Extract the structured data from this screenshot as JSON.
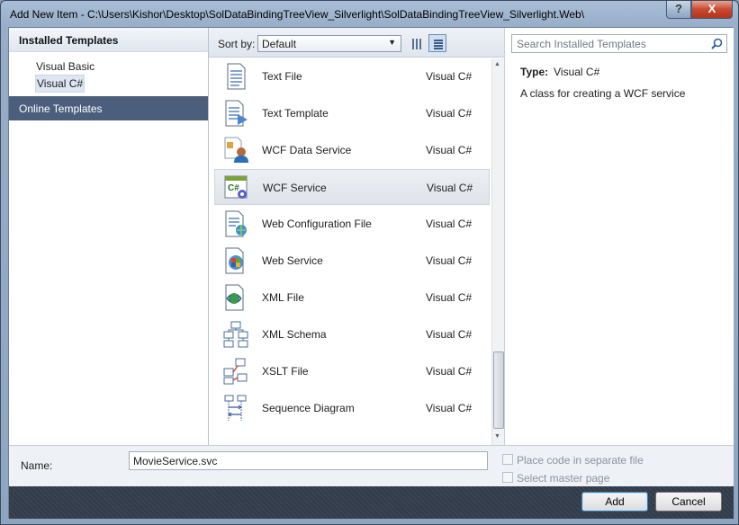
{
  "window": {
    "title": "Add New Item - C:\\Users\\Kishor\\Desktop\\SolDataBindingTreeView_Silverlight\\SolDataBindingTreeView_Silverlight.Web\\",
    "help_label": "?",
    "close_label": "X"
  },
  "left": {
    "installed_heading": "Installed Templates",
    "tree": [
      "Visual Basic",
      "Visual C#"
    ],
    "selected_tree": "Visual C#",
    "online_heading": "Online Templates"
  },
  "toolbar": {
    "sort_label": "Sort by:",
    "sort_value": "Default",
    "search_placeholder": "Search Installed Templates"
  },
  "templates": [
    {
      "name": "Text File",
      "lang": "Visual C#",
      "icon": "text-file-icon"
    },
    {
      "name": "Text Template",
      "lang": "Visual C#",
      "icon": "text-template-icon"
    },
    {
      "name": "WCF Data Service",
      "lang": "Visual C#",
      "icon": "wcf-data-service-icon"
    },
    {
      "name": "WCF Service",
      "lang": "Visual C#",
      "icon": "wcf-service-icon",
      "selected": true
    },
    {
      "name": "Web Configuration File",
      "lang": "Visual C#",
      "icon": "web-config-icon"
    },
    {
      "name": "Web Service",
      "lang": "Visual C#",
      "icon": "web-service-icon"
    },
    {
      "name": "XML File",
      "lang": "Visual C#",
      "icon": "xml-file-icon"
    },
    {
      "name": "XML Schema",
      "lang": "Visual C#",
      "icon": "xml-schema-icon"
    },
    {
      "name": "XSLT File",
      "lang": "Visual C#",
      "icon": "xslt-file-icon"
    },
    {
      "name": "Sequence Diagram",
      "lang": "Visual C#",
      "icon": "sequence-diagram-icon"
    }
  ],
  "details": {
    "type_label": "Type:",
    "type_value": "Visual C#",
    "description": "A class for creating a WCF service"
  },
  "bottom": {
    "name_label": "Name:",
    "name_value": "MovieService.svc",
    "place_code_label": "Place code in separate file",
    "master_page_label": "Select master page",
    "add_label": "Add",
    "cancel_label": "Cancel"
  }
}
